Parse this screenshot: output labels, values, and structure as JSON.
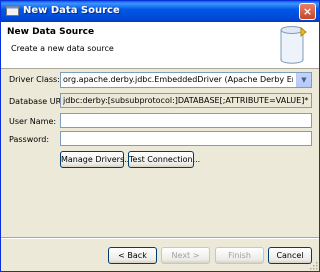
{
  "window": {
    "title": "New Data Source",
    "close_label": "×"
  },
  "header": {
    "title": "New Data Source",
    "description": "Create a new data source",
    "icon": "database-icon"
  },
  "form": {
    "driver_class_label": "Driver Class:",
    "driver_class_value": "org.apache.derby.jdbc.EmbeddedDriver (Apache Derby Embedded Driver)",
    "database_url_label": "Database URL:",
    "database_url_value": "jdbc:derby:[subsubprotocol:]DATABASE[;ATTRIBUTE=VALUE]*",
    "user_name_label": "User Name:",
    "user_name_value": "",
    "password_label": "Password:",
    "password_value": ""
  },
  "actions": {
    "manage_drivers": "Manage Drivers...",
    "test_connection": "Test Connection..."
  },
  "footer": {
    "back": "< Back",
    "next": "Next >",
    "finish": "Finish",
    "cancel": "Cancel"
  }
}
